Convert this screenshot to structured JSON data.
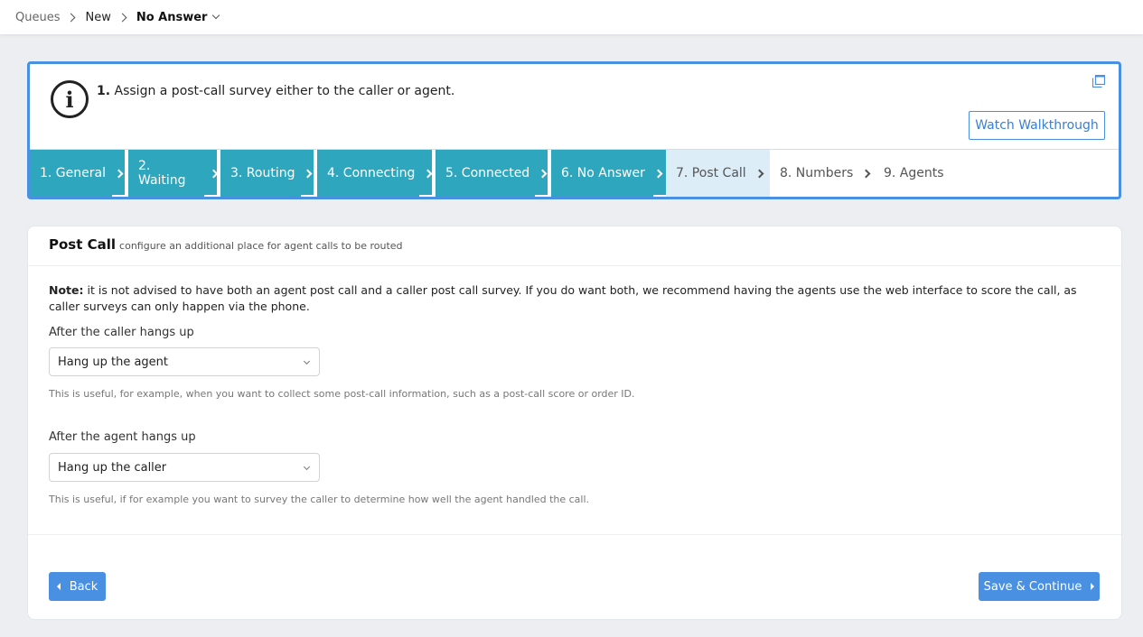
{
  "breadcrumb": {
    "items": [
      "Queues",
      "New",
      "No Answer"
    ]
  },
  "walkthrough": {
    "step_number": "1.",
    "text": "Assign a post-call survey either to the caller or agent.",
    "watch_button": "Watch Walkthrough",
    "steps": [
      {
        "label": "1. General",
        "state": "done"
      },
      {
        "label": "2. Waiting",
        "state": "done"
      },
      {
        "label": "3. Routing",
        "state": "done"
      },
      {
        "label": "4. Connecting",
        "state": "done"
      },
      {
        "label": "5. Connected",
        "state": "done"
      },
      {
        "label": "6. No Answer",
        "state": "done"
      },
      {
        "label": "7. Post Call",
        "state": "current"
      },
      {
        "label": "8. Numbers",
        "state": "todo"
      },
      {
        "label": "9. Agents",
        "state": "todo"
      }
    ]
  },
  "card": {
    "title": "Post Call",
    "subtitle": "configure an additional place for agent calls to be routed",
    "note_label": "Note:",
    "note_text": "it is not advised to have both an agent post call and a caller post call survey. If you do want both, we recommend having the agents use the web interface to score the call, as caller surveys can only happen via the phone.",
    "caller_label": "After the caller hangs up",
    "caller_value": "Hang up the agent",
    "caller_help": "This is useful, for example, when you want to collect some post-call information, such as a post-call score or order ID.",
    "agent_label": "After the agent hangs up",
    "agent_value": "Hang up the caller",
    "agent_help": "This is useful, if for example you want to survey the caller to determine how well the agent handled the call.",
    "back_button": "Back",
    "save_button": "Save & Continue"
  },
  "colors": {
    "accent": "#4a90e2",
    "step_done": "#2ea6bd",
    "step_current": "#dcedf8"
  }
}
